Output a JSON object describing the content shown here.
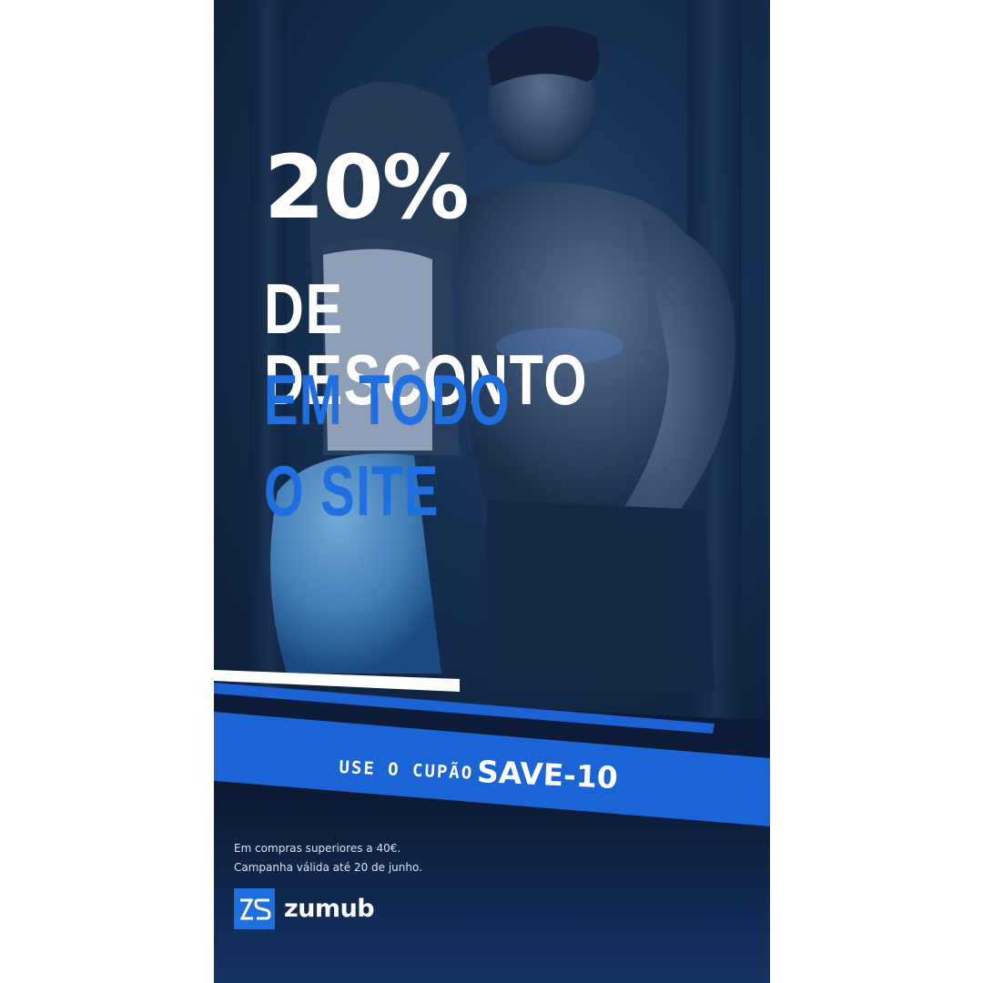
{
  "promo": {
    "percent": "20%",
    "line1": "DE DESCONTO",
    "line2": "EM TODO",
    "line3": "O SITE"
  },
  "coupon": {
    "label": "USE O CUPÃO",
    "code": "SAVE-10"
  },
  "terms": {
    "line1": "Em compras superiores a 40€.",
    "line2": "Campanha válida até 20 de junho."
  },
  "brand": {
    "name": "zumub",
    "logo_mark": "ZS",
    "color": "#1e6fe0"
  },
  "colors": {
    "accent_blue": "#1f6fe0",
    "band_blue": "#1a64d6",
    "dark_navy": "#0a1a38",
    "white": "#ffffff"
  }
}
